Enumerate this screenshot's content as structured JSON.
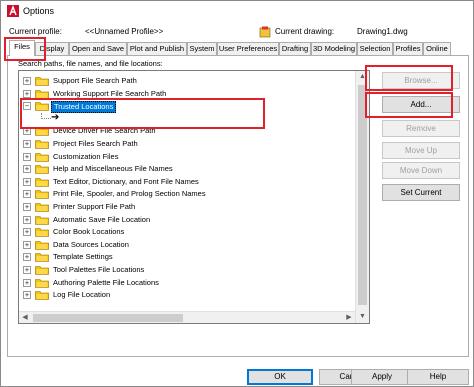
{
  "window": {
    "title": "Options"
  },
  "profile": {
    "current_profile_label": "Current profile:",
    "current_profile_value": "<<Unnamed Profile>>",
    "current_drawing_label": "Current drawing:",
    "current_drawing_value": "Drawing1.dwg"
  },
  "tabs": [
    {
      "label": "Files"
    },
    {
      "label": "Display"
    },
    {
      "label": "Open and Save"
    },
    {
      "label": "Plot and Publish"
    },
    {
      "label": "System"
    },
    {
      "label": "User Preferences"
    },
    {
      "label": "Drafting"
    },
    {
      "label": "3D Modeling"
    },
    {
      "label": "Selection"
    },
    {
      "label": "Profiles"
    },
    {
      "label": "Online"
    }
  ],
  "files": {
    "caption": "Search paths, file names, and file locations:",
    "tree": [
      {
        "label": "Support File Search Path",
        "expander": "+"
      },
      {
        "label": "Working Support File Search Path",
        "expander": "+"
      },
      {
        "label": "Trusted Locations",
        "expander": "−",
        "selected": true
      },
      {
        "label": "",
        "child_arrow": "➔"
      },
      {
        "label": "Device Driver File Search Path",
        "expander": "+"
      },
      {
        "label": "Project Files Search Path",
        "expander": "+"
      },
      {
        "label": "Customization Files",
        "expander": "+"
      },
      {
        "label": "Help and Miscellaneous File Names",
        "expander": "+"
      },
      {
        "label": "Text Editor, Dictionary, and Font File Names",
        "expander": "+"
      },
      {
        "label": "Print File, Spooler, and Prolog Section Names",
        "expander": "+"
      },
      {
        "label": "Printer Support File Path",
        "expander": "+"
      },
      {
        "label": "Automatic Save File Location",
        "expander": "+"
      },
      {
        "label": "Color Book Locations",
        "expander": "+"
      },
      {
        "label": "Data Sources Location",
        "expander": "+"
      },
      {
        "label": "Template Settings",
        "expander": "+"
      },
      {
        "label": "Tool Palettes File Locations",
        "expander": "+"
      },
      {
        "label": "Authoring Palette File Locations",
        "expander": "+"
      },
      {
        "label": "Log File Location",
        "expander": "+"
      }
    ],
    "buttons": {
      "browse": "Browse...",
      "add": "Add...",
      "remove": "Remove",
      "move_up": "Move Up",
      "move_down": "Move Down",
      "set_current": "Set Current"
    }
  },
  "footer": {
    "ok": "OK",
    "cancel": "Cancel",
    "apply": "Apply",
    "help": "Help"
  },
  "colors": {
    "selection": "#0078d7",
    "highlight_box": "#e0202a",
    "folder": "#f5c400"
  },
  "icons": {
    "app": "autocad-red-a-icon",
    "drawing": "drawing-file-icon",
    "folder": "folder-icon"
  }
}
